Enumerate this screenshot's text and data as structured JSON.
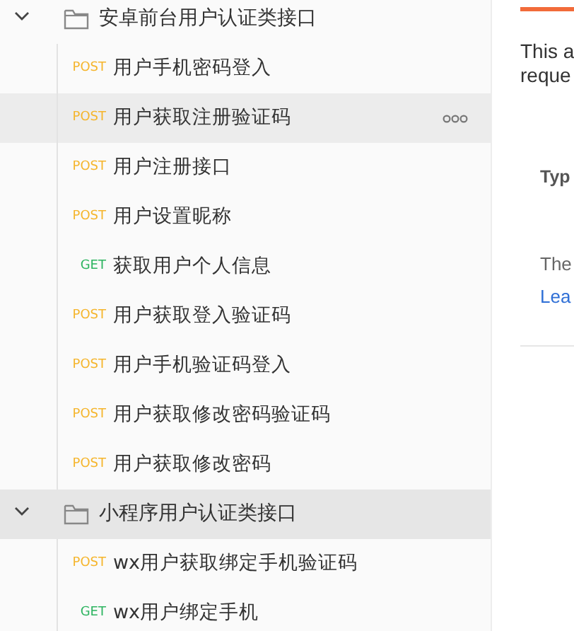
{
  "sidebar": {
    "folders": [
      {
        "name": "安卓前台用户认证类接口",
        "expanded": true,
        "selected": false,
        "children": [
          {
            "method": "POST",
            "name": "用户手机密码登入",
            "selected": false
          },
          {
            "method": "POST",
            "name": "用户获取注册验证码",
            "selected": true
          },
          {
            "method": "POST",
            "name": "用户注册接口",
            "selected": false
          },
          {
            "method": "POST",
            "name": "用户设置昵称",
            "selected": false
          },
          {
            "method": "GET",
            "name": "获取用户个人信息",
            "selected": false
          },
          {
            "method": "POST",
            "name": "用户获取登入验证码",
            "selected": false
          },
          {
            "method": "POST",
            "name": "用户手机验证码登入",
            "selected": false
          },
          {
            "method": "POST",
            "name": "用户获取修改密码验证码",
            "selected": false
          },
          {
            "method": "POST",
            "name": "用户获取修改密码",
            "selected": false
          }
        ]
      },
      {
        "name": "小程序用户认证类接口",
        "expanded": true,
        "selected": true,
        "children": [
          {
            "method": "POST",
            "name": "wx用户获取绑定手机验证码",
            "selected": false
          },
          {
            "method": "GET",
            "name": "wx用户绑定手机",
            "selected": false
          }
        ]
      }
    ]
  },
  "panel": {
    "intro_lines": [
      "This a",
      "reque"
    ],
    "heading": "Typ",
    "text": "The",
    "link": "Lea"
  }
}
